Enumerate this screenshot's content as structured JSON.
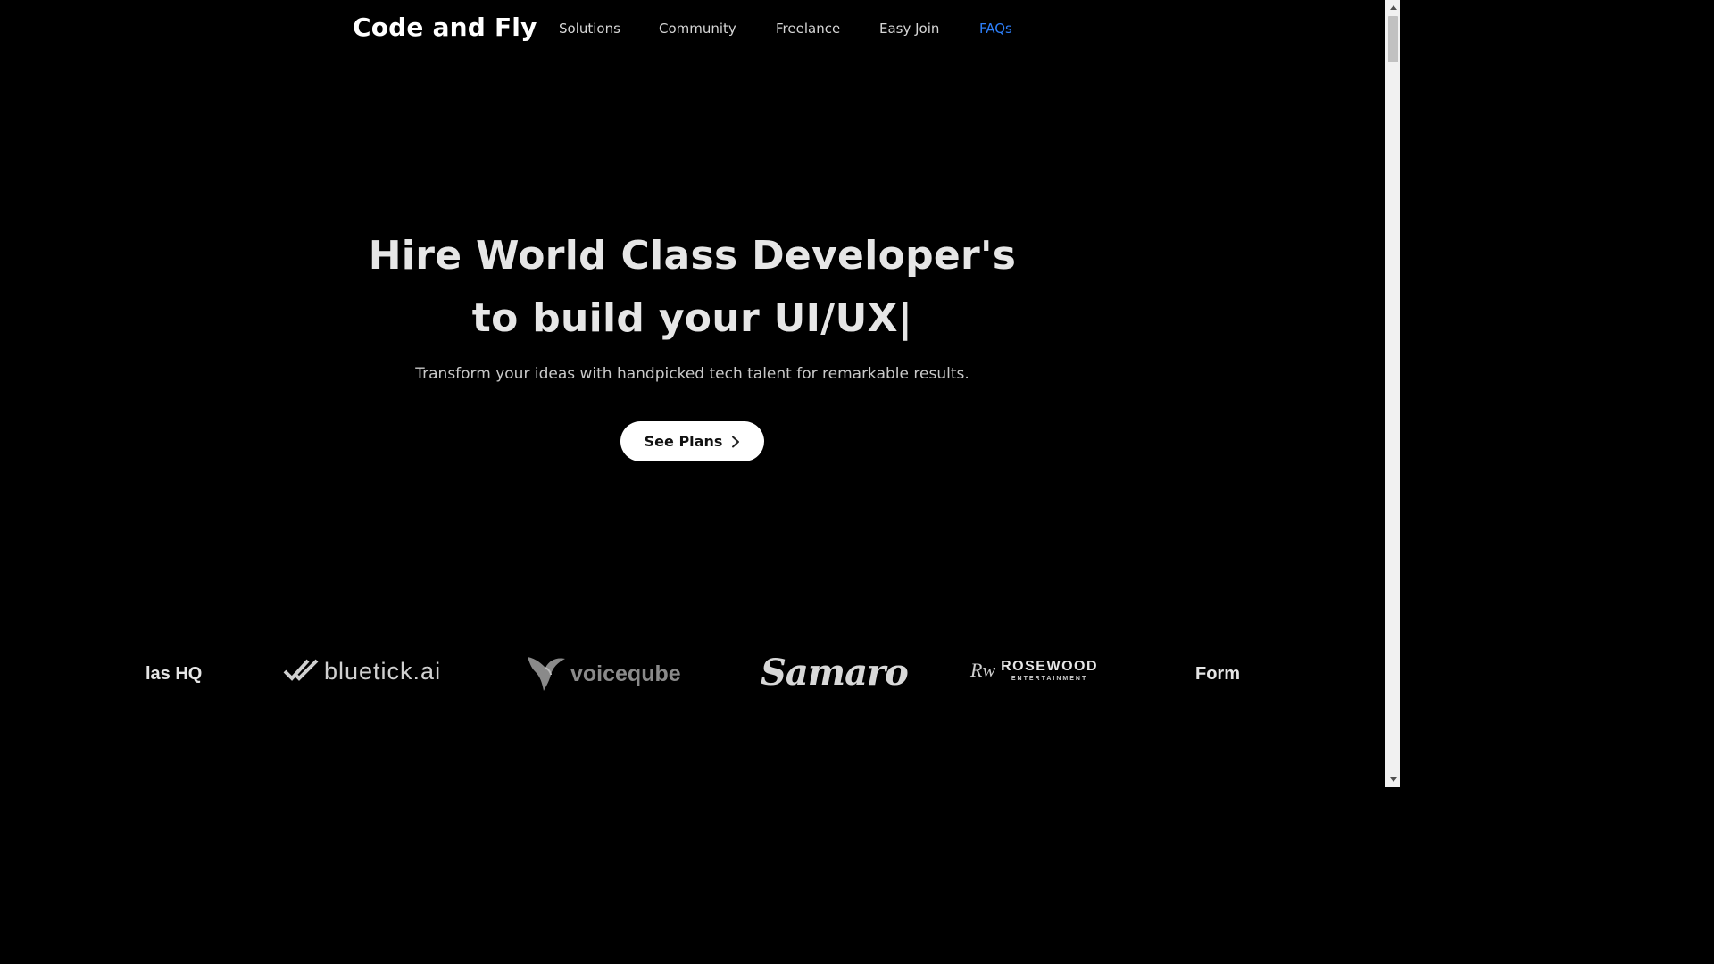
{
  "nav": {
    "brand": "Code and Fly",
    "links": [
      {
        "label": "Solutions"
      },
      {
        "label": "Community"
      },
      {
        "label": "Freelance"
      },
      {
        "label": "Easy Join"
      },
      {
        "label": "FAQs",
        "active": true
      }
    ],
    "active_color": "#2d7ff9"
  },
  "hero": {
    "title_line1": "Hire World Class Developer's",
    "title_line2": "to build your UI/UX|",
    "subtitle": "Transform your ideas with handpicked tech talent for remarkable results.",
    "cta_label": "See Plans",
    "cta_icon": "chevron-right-icon"
  },
  "logos": {
    "atlas": "las HQ",
    "bluetick": "bluetick.ai",
    "voiceqube": "voiceqube",
    "samaro": "Samaro",
    "rosewood_mark": "Rw",
    "rosewood": "ROSEWOOD",
    "rosewood_sub": "ENTERTAINMENT",
    "form": "Form"
  },
  "colors": {
    "background": "#000000",
    "text_primary": "#ffffff",
    "cta_background": "#ffffff"
  }
}
